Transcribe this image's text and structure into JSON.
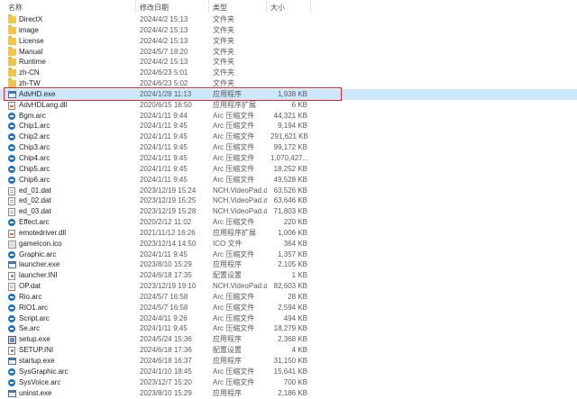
{
  "header": {
    "name": "名称",
    "date": "修改日期",
    "type": "类型",
    "size": "大小"
  },
  "rows": [
    {
      "name": "DirectX",
      "date": "2024/4/2 15:13",
      "type": "文件夹",
      "size": "",
      "icon": "folder"
    },
    {
      "name": "image",
      "date": "2024/4/2 15:13",
      "type": "文件夹",
      "size": "",
      "icon": "folder"
    },
    {
      "name": "License",
      "date": "2024/4/2 15:13",
      "type": "文件夹",
      "size": "",
      "icon": "folder"
    },
    {
      "name": "Manual",
      "date": "2024/5/7 18:20",
      "type": "文件夹",
      "size": "",
      "icon": "folder"
    },
    {
      "name": "Runtime",
      "date": "2024/4/2 15:13",
      "type": "文件夹",
      "size": "",
      "icon": "folder"
    },
    {
      "name": "zh-CN",
      "date": "2024/6/23 5:01",
      "type": "文件夹",
      "size": "",
      "icon": "folder"
    },
    {
      "name": "zh-TW",
      "date": "2024/6/23 5:02",
      "type": "文件夹",
      "size": "",
      "icon": "folder"
    },
    {
      "name": "AdvHD.exe",
      "date": "2024/1/28 11:13",
      "type": "应用程序",
      "size": "1,938 KB",
      "icon": "exe",
      "selected": true
    },
    {
      "name": "AdvHDLang.dll",
      "date": "2020/6/15 16:50",
      "type": "应用程序扩展",
      "size": "6 KB",
      "icon": "dll"
    },
    {
      "name": "Bgm.arc",
      "date": "2024/1/11 9:44",
      "type": "Arc 压缩文件",
      "size": "44,321 KB",
      "icon": "arc"
    },
    {
      "name": "Chip1.arc",
      "date": "2024/1/11 9:45",
      "type": "Arc 压缩文件",
      "size": "9,194 KB",
      "icon": "arc"
    },
    {
      "name": "Chip2.arc",
      "date": "2024/1/11 9:45",
      "type": "Arc 压缩文件",
      "size": "291,621 KB",
      "icon": "arc"
    },
    {
      "name": "Chip3.arc",
      "date": "2024/1/11 9:45",
      "type": "Arc 压缩文件",
      "size": "99,172 KB",
      "icon": "arc"
    },
    {
      "name": "Chip4.arc",
      "date": "2024/1/11 9:45",
      "type": "Arc 压缩文件",
      "size": "1,070,427...",
      "icon": "arc"
    },
    {
      "name": "Chip5.arc",
      "date": "2024/1/11 9:45",
      "type": "Arc 压缩文件",
      "size": "18,252 KB",
      "icon": "arc"
    },
    {
      "name": "Chip6.arc",
      "date": "2024/1/11 9:45",
      "type": "Arc 压缩文件",
      "size": "49,528 KB",
      "icon": "arc"
    },
    {
      "name": "ed_01.dat",
      "date": "2023/12/19 15:24",
      "type": "NCH.VideoPad.d...",
      "size": "63,526 KB",
      "icon": "doc"
    },
    {
      "name": "ed_02.dat",
      "date": "2023/12/19 15:25",
      "type": "NCH.VideoPad.d...",
      "size": "63,646 KB",
      "icon": "doc"
    },
    {
      "name": "ed_03.dat",
      "date": "2023/12/19 15:28",
      "type": "NCH.VideoPad.d...",
      "size": "71,803 KB",
      "icon": "doc"
    },
    {
      "name": "Effect.arc",
      "date": "2020/2/12 11:02",
      "type": "Arc 压缩文件",
      "size": "220 KB",
      "icon": "arc"
    },
    {
      "name": "emotedriver.dll",
      "date": "2021/11/12 16:26",
      "type": "应用程序扩展",
      "size": "1,006 KB",
      "icon": "dll"
    },
    {
      "name": "gameIcon.ico",
      "date": "2023/12/14 14:50",
      "type": "ICO 文件",
      "size": "364 KB",
      "icon": "ico"
    },
    {
      "name": "Graphic.arc",
      "date": "2024/1/11 9:45",
      "type": "Arc 压缩文件",
      "size": "1,357 KB",
      "icon": "arc"
    },
    {
      "name": "launcher.exe",
      "date": "2023/8/10 15:29",
      "type": "应用程序",
      "size": "2,105 KB",
      "icon": "exe"
    },
    {
      "name": "launcher.INI",
      "date": "2024/6/18 17:35",
      "type": "配置设置",
      "size": "1 KB",
      "icon": "ini"
    },
    {
      "name": "OP.dat",
      "date": "2023/12/19 19:10",
      "type": "NCH.VideoPad.d...",
      "size": "82,603 KB",
      "icon": "doc"
    },
    {
      "name": "Rio.arc",
      "date": "2024/5/7 16:58",
      "type": "Arc 压缩文件",
      "size": "28 KB",
      "icon": "arc"
    },
    {
      "name": "RIO1.arc",
      "date": "2024/5/7 16:58",
      "type": "Arc 压缩文件",
      "size": "2,594 KB",
      "icon": "arc"
    },
    {
      "name": "Script.arc",
      "date": "2024/4/11 9:26",
      "type": "Arc 压缩文件",
      "size": "494 KB",
      "icon": "arc"
    },
    {
      "name": "Se.arc",
      "date": "2024/1/11 9:45",
      "type": "Arc 压缩文件",
      "size": "18,279 KB",
      "icon": "arc"
    },
    {
      "name": "setup.exe",
      "date": "2024/5/24 15:36",
      "type": "应用程序",
      "size": "2,368 KB",
      "icon": "setup"
    },
    {
      "name": "SETUP.INI",
      "date": "2024/6/18 17:36",
      "type": "配置设置",
      "size": "4 KB",
      "icon": "ini"
    },
    {
      "name": "startup.exe",
      "date": "2024/6/18 16:37",
      "type": "应用程序",
      "size": "31,150 KB",
      "icon": "exe"
    },
    {
      "name": "SysGraphic.arc",
      "date": "2024/1/10 18:45",
      "type": "Arc 压缩文件",
      "size": "15,641 KB",
      "icon": "arc"
    },
    {
      "name": "SysVoice.arc",
      "date": "2023/12/7 15:20",
      "type": "Arc 压缩文件",
      "size": "700 KB",
      "icon": "arc"
    },
    {
      "name": "uninst.exe",
      "date": "2023/8/10 15:29",
      "type": "应用程序",
      "size": "2,186 KB",
      "icon": "exe"
    }
  ]
}
